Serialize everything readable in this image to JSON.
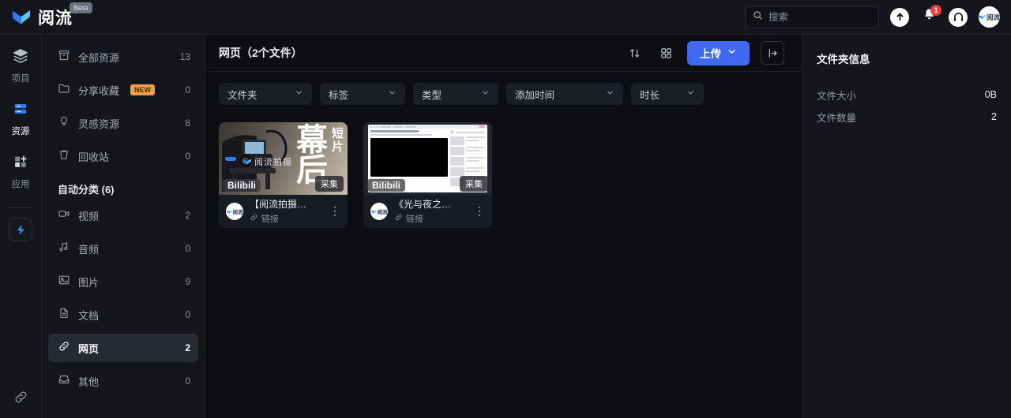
{
  "brand": {
    "name": "阅流",
    "badge": "Beta",
    "logo_icon": "chevron-logo-icon"
  },
  "topbar": {
    "search": {
      "placeholder": "搜索",
      "value": "",
      "icon": "search-icon"
    },
    "upload_icon": "upload-circle-icon",
    "notification_icon": "bell-icon",
    "notification_count": "1",
    "support_icon": "headphones-icon",
    "avatar_label": "阅流"
  },
  "rail": {
    "items": [
      {
        "label": "项目",
        "icon": "layers-icon",
        "active": false
      },
      {
        "label": "资源",
        "icon": "database-icon",
        "active": true
      },
      {
        "label": "应用",
        "icon": "grid-plus-icon",
        "active": false
      }
    ],
    "app_icon": "lightning-app-icon",
    "bottom_icon": "link-icon"
  },
  "sidebar": {
    "items": [
      {
        "label": "全部资源",
        "count": "13",
        "icon": "archive-icon",
        "active": false
      },
      {
        "label": "分享收藏",
        "count": "0",
        "icon": "folder-icon",
        "badge": "NEW",
        "active": false
      },
      {
        "label": "灵感资源",
        "count": "8",
        "icon": "bulb-icon",
        "active": false
      },
      {
        "label": "回收站",
        "count": "0",
        "icon": "trash-icon",
        "active": false
      }
    ],
    "section_title": "自动分类 (6)",
    "categories": [
      {
        "label": "视频",
        "count": "2",
        "icon": "video-icon",
        "active": false
      },
      {
        "label": "音频",
        "count": "0",
        "icon": "music-icon",
        "active": false
      },
      {
        "label": "图片",
        "count": "9",
        "icon": "image-icon",
        "active": false
      },
      {
        "label": "文档",
        "count": "0",
        "icon": "document-icon",
        "active": false
      },
      {
        "label": "网页",
        "count": "2",
        "icon": "link-icon",
        "active": true
      },
      {
        "label": "其他",
        "count": "0",
        "icon": "inbox-icon",
        "active": false
      }
    ]
  },
  "main": {
    "title": "网页（2个文件）",
    "sort_icon": "sort-arrows-icon",
    "view_icon": "grid-view-icon",
    "upload_label": "上传",
    "upload_chevron": "chevron-down-icon",
    "panel_toggle_icon": "panel-expand-icon",
    "filters": [
      {
        "label": "文件夹"
      },
      {
        "label": "标签"
      },
      {
        "label": "类型"
      },
      {
        "label": "添加时间"
      },
      {
        "label": "时长"
      }
    ],
    "cards": [
      {
        "title": "【阅流拍摄…",
        "subtitle": "链接",
        "subtitle_icon": "link-icon",
        "source": "Bilibili",
        "collect_label": "采集",
        "overlay_main_1": "幕",
        "overlay_main_2": "后",
        "overlay_side": "短片",
        "watermark": "阅流拍摄",
        "avatar_label": "阅流",
        "menu_icon": "more-vertical-icon"
      },
      {
        "title": "《光与夜之…",
        "subtitle": "链接",
        "subtitle_icon": "link-icon",
        "source": "Bilibili",
        "collect_label": "采集",
        "avatar_label": "阅流",
        "menu_icon": "more-vertical-icon"
      }
    ]
  },
  "right_panel": {
    "title": "文件夹信息",
    "rows": [
      {
        "key": "文件大小",
        "value": "0B"
      },
      {
        "key": "文件数量",
        "value": "2"
      }
    ]
  },
  "colors": {
    "accent": "#4068f0",
    "badge_new": "#f0a04b",
    "badge_alert": "#e8403a",
    "background": "#0d0e12",
    "panel": "#15161c"
  }
}
